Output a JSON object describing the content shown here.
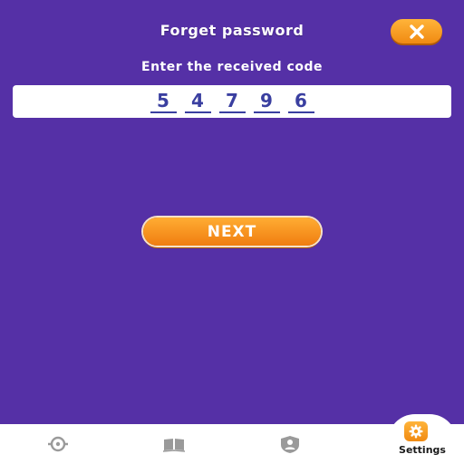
{
  "header": {
    "title": "Forget password",
    "close_icon": "close-icon"
  },
  "prompt": "Enter the received code",
  "code": {
    "digits": [
      "5",
      "4",
      "7",
      "9",
      "6"
    ]
  },
  "next_label": "NEXT",
  "bottom_nav": {
    "items": [
      {
        "icon": "refresh-icon"
      },
      {
        "icon": "book-icon"
      },
      {
        "icon": "profile-icon"
      },
      {
        "icon": "gear-icon",
        "label": "Settings"
      }
    ]
  },
  "colors": {
    "background": "#5530a6",
    "accent_orange": "#f59a1f",
    "digit": "#3a3fa0"
  }
}
